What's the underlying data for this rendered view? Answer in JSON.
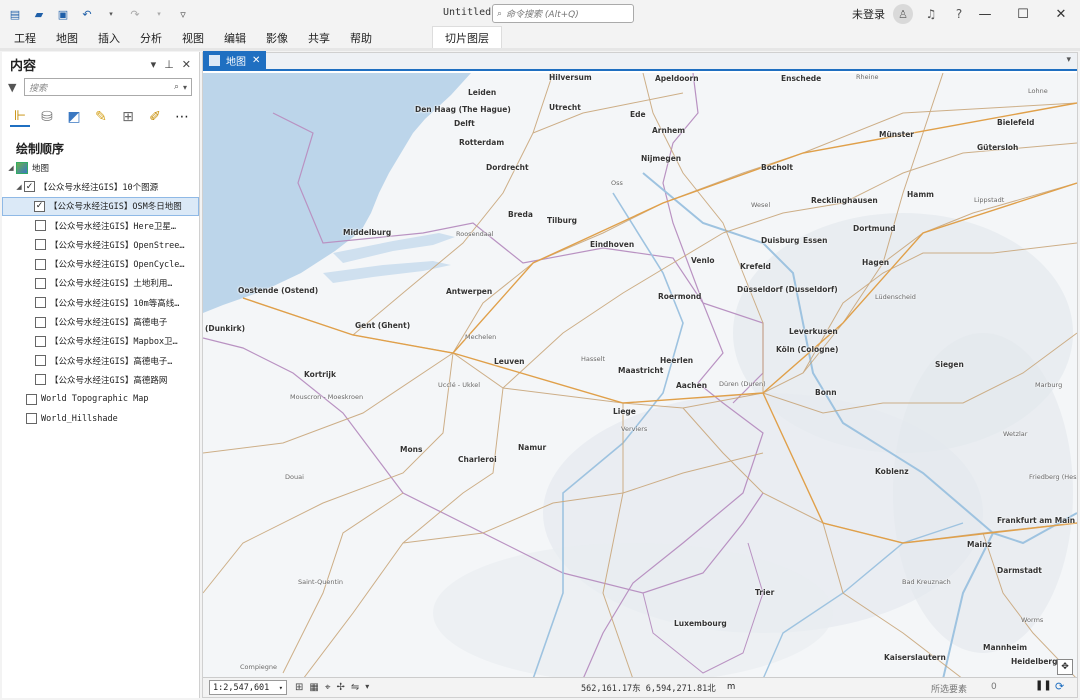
{
  "window": {
    "title": "Untitled",
    "command_search_placeholder": "命令搜索 (Alt+Q)",
    "user": "未登录"
  },
  "ribbon": {
    "tabs": [
      "工程",
      "地图",
      "插入",
      "分析",
      "视图",
      "编辑",
      "影像",
      "共享",
      "帮助"
    ],
    "context_tab": "切片图层"
  },
  "contents": {
    "title": "内容",
    "search_placeholder": "搜索",
    "drawing_order": "绘制顺序",
    "map_name": "地图",
    "group_layer": "【公众号水经注GIS】10个图源",
    "layers": [
      "【公众号水经注GIS】OSM冬日地图",
      "【公众号水经注GIS】Here卫星…",
      "【公众号水经注GIS】OpenStree…",
      "【公众号水经注GIS】OpenCycle…",
      "【公众号水经注GIS】土地利用…",
      "【公众号水经注GIS】10m等高线…",
      "【公众号水经注GIS】高德电子",
      "【公众号水经注GIS】Mapbox卫…",
      "【公众号水经注GIS】高德电子…",
      "【公众号水经注GIS】高德路网"
    ],
    "basemaps": [
      "World Topographic Map",
      "World_Hillshade"
    ]
  },
  "map_view": {
    "tab_label": "地图",
    "cities": [
      {
        "name": "Hilversum"
      },
      {
        "name": "Apeldoorn"
      },
      {
        "name": "Enschede"
      },
      {
        "name": "Leiden"
      },
      {
        "name": "Den Haag (The Hague)"
      },
      {
        "name": "Utrecht"
      },
      {
        "name": "Delft"
      },
      {
        "name": "Ede"
      },
      {
        "name": "Arnhem"
      },
      {
        "name": "Münster"
      },
      {
        "name": "Bielefeld"
      },
      {
        "name": "Rotterdam"
      },
      {
        "name": "Gütersloh"
      },
      {
        "name": "Nijmegen"
      },
      {
        "name": "Dordrecht"
      },
      {
        "name": "Bocholt"
      },
      {
        "name": "Hamm"
      },
      {
        "name": "Breda"
      },
      {
        "name": "Tilburg"
      },
      {
        "name": "Recklinghausen"
      },
      {
        "name": "Middelburg"
      },
      {
        "name": "Dortmund"
      },
      {
        "name": "Eindhoven"
      },
      {
        "name": "Duisburg"
      },
      {
        "name": "Essen"
      },
      {
        "name": "Venlo"
      },
      {
        "name": "Krefeld"
      },
      {
        "name": "Hagen"
      },
      {
        "name": "Oostende (Ostend)"
      },
      {
        "name": "Antwerpen"
      },
      {
        "name": "Roermond"
      },
      {
        "name": "Düsseldorf (Dusseldorf)"
      },
      {
        "name": "Gent (Ghent)"
      },
      {
        "name": "Leverkusen"
      },
      {
        "name": "(Dunkirk)"
      },
      {
        "name": "Köln (Cologne)"
      },
      {
        "name": "Leuven"
      },
      {
        "name": "Heerlen"
      },
      {
        "name": "Maastricht"
      },
      {
        "name": "Siegen"
      },
      {
        "name": "Kortrijk"
      },
      {
        "name": "Aachen"
      },
      {
        "name": "Bonn"
      },
      {
        "name": "Liege"
      },
      {
        "name": "Mons"
      },
      {
        "name": "Namur"
      },
      {
        "name": "Charleroi"
      },
      {
        "name": "Koblenz"
      },
      {
        "name": "Frankfurt am Main"
      },
      {
        "name": "Mainz"
      },
      {
        "name": "Darmstadt"
      },
      {
        "name": "Trier"
      },
      {
        "name": "Luxembourg"
      },
      {
        "name": "Kaiserslautern"
      },
      {
        "name": "Mannheim"
      },
      {
        "name": "Heidelberg"
      }
    ],
    "minor_places": [
      {
        "name": "Rheine"
      },
      {
        "name": "Lohne"
      },
      {
        "name": "Oss"
      },
      {
        "name": "Wesel"
      },
      {
        "name": "Lippstadt"
      },
      {
        "name": "Roosendaal"
      },
      {
        "name": "Mechelen"
      },
      {
        "name": "Hasselt"
      },
      {
        "name": "Lüdenscheid"
      },
      {
        "name": "Düren (Duren)"
      },
      {
        "name": "Ucclé - Ukkel"
      },
      {
        "name": "Mouscron - Moeskroen"
      },
      {
        "name": "Verviers"
      },
      {
        "name": "Marburg"
      },
      {
        "name": "Wetzlar"
      },
      {
        "name": "Friedberg (Hessen)"
      },
      {
        "name": "Douai"
      },
      {
        "name": "Bad Kreuznach"
      },
      {
        "name": "Saint-Quentin"
      },
      {
        "name": "Worms"
      },
      {
        "name": "Compiegne"
      }
    ]
  },
  "status": {
    "scale": "1:2,547,601",
    "coords": "562,161.17东 6,594,271.81北",
    "coord_unit": "m",
    "selected_features": "所选要素",
    "selected_count": "0"
  }
}
